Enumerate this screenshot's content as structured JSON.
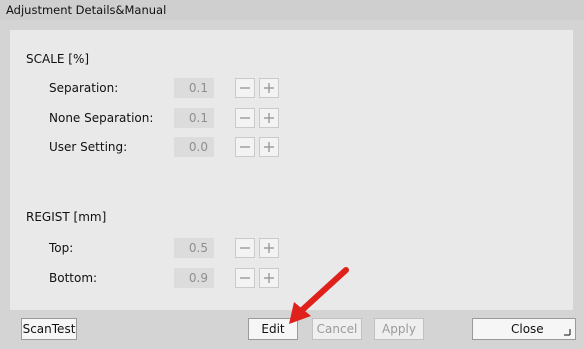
{
  "window": {
    "title": "Adjustment Details&Manual"
  },
  "scale": {
    "heading": "SCALE [%]",
    "rows": [
      {
        "label": "Separation:",
        "value": "0.1"
      },
      {
        "label": "None Separation:",
        "value": "0.1"
      },
      {
        "label": "User Setting:",
        "value": "0.0"
      }
    ]
  },
  "regist": {
    "heading": "REGIST [mm]",
    "rows": [
      {
        "label": "Top:",
        "value": "0.5"
      },
      {
        "label": "Bottom:",
        "value": "0.9"
      }
    ]
  },
  "footer": {
    "scantest_label": "ScanTest",
    "edit_label": "Edit",
    "cancel_label": "Cancel",
    "apply_label": "Apply",
    "close_label": "Close"
  },
  "icons": {
    "minus": "minus-icon",
    "plus": "plus-icon",
    "resize": "resize-grip-icon",
    "arrow": "red-arrow-annotation"
  },
  "colors": {
    "annotation_arrow": "#e0201b",
    "disabled_text": "#9a9a9a",
    "panel_bg": "#e9e9e9",
    "frame_bg": "#d4d4d4"
  }
}
